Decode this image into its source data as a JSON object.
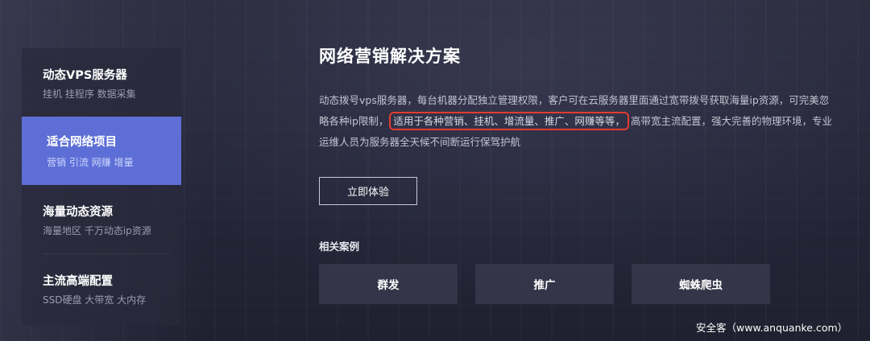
{
  "sidebar": {
    "items": [
      {
        "title": "动态VPS服务器",
        "subtitle": "挂机 挂程序 数据采集"
      },
      {
        "title": "适合网络项目",
        "subtitle": "营销 引流 网赚 增量"
      },
      {
        "title": "海量动态资源",
        "subtitle": "海量地区 千万动态ip资源"
      },
      {
        "title": "主流高端配置",
        "subtitle": "SSD硬盘 大带宽 大内存"
      }
    ]
  },
  "main": {
    "title": "网络营销解决方案",
    "description": {
      "line1": "动态拨号vps服务器，每台机器分配独立管理权限，客户可在云服务器里面通过宽带拨号获取海量ip资源，可完美忽",
      "line2_prefix": "略各种ip限制，",
      "line2_highlight": "适用于各种营销、挂机、增流量、推广、网赚等等，",
      "line2_suffix": "高带宽主流配置，强大完善的物理环境，专业",
      "line3": "运维人员为服务器全天候不间断运行保驾护航"
    },
    "try_button": "立即体验",
    "cases_label": "相关案例",
    "cases": [
      "群发",
      "推广",
      "蜘蛛爬虫"
    ]
  },
  "watermark": "安全客（www.anquanke.com）",
  "colors": {
    "active_item": "#5d6fd6",
    "highlight_border": "#e23b2f",
    "background": "#252638"
  }
}
